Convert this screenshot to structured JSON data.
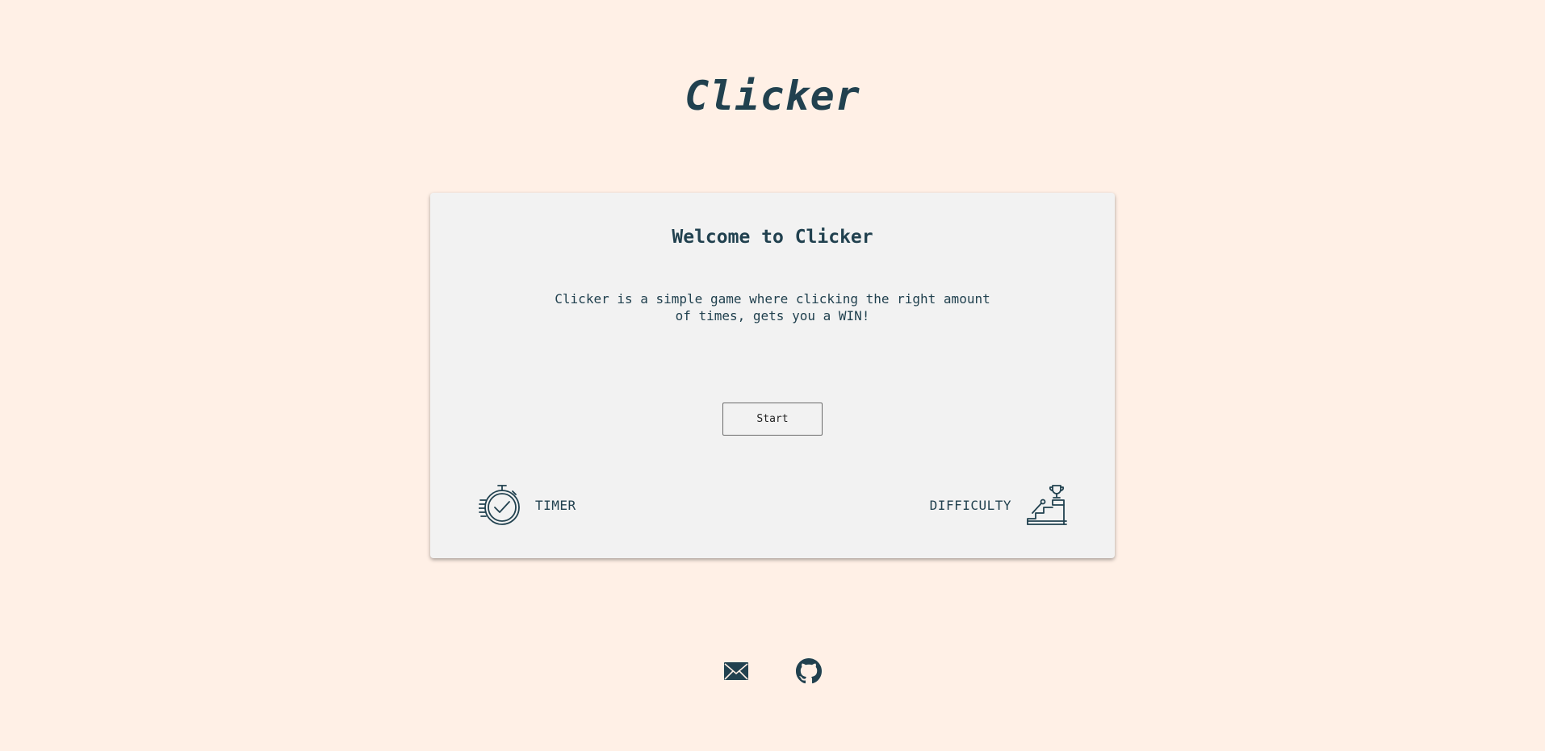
{
  "app": {
    "title": "Clicker"
  },
  "card": {
    "heading": "Welcome to Clicker",
    "description": "Clicker is a simple game where clicking the right amount of times, gets you a WIN!",
    "start_label": "Start",
    "options": {
      "timer": {
        "label": "TIMER",
        "icon": "stopwatch-icon"
      },
      "difficulty": {
        "label": "DIFFICULTY",
        "icon": "podium-trophy-icon"
      }
    }
  },
  "footer": {
    "links": [
      {
        "name": "email",
        "icon": "mail-icon"
      },
      {
        "name": "github",
        "icon": "github-icon"
      }
    ]
  },
  "colors": {
    "background": "#fff0e6",
    "card": "#f2f2f2",
    "text": "#21414f"
  }
}
